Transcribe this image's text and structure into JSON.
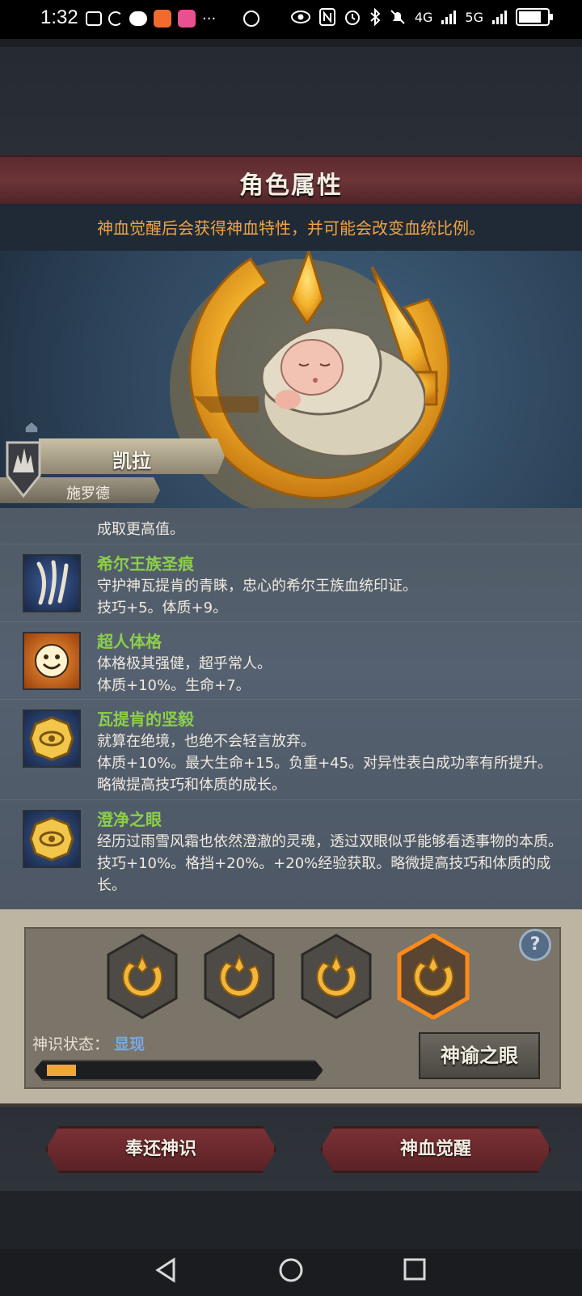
{
  "status_bar": {
    "time": "1:32",
    "right_labels": [
      "4G",
      "5G"
    ]
  },
  "header": {
    "title": "角色属性",
    "info": "神血觉醒后会获得神血特性，并可能会改变血统比例。"
  },
  "character": {
    "name": "凯拉",
    "family": "施罗德"
  },
  "traits_list": {
    "partial_line": "成取更高值。",
    "items": [
      {
        "name": "希尔王族圣痕",
        "icon": "claw-icon",
        "lines": [
          "守护神瓦提肯的青睐，忠心的希尔王族血统印证。",
          "技巧+5。体质+9。"
        ]
      },
      {
        "name": "超人体格",
        "icon": "smile-face-icon",
        "lines": [
          "体格极其强健，超乎常人。",
          "体质+10%。生命+7。"
        ]
      },
      {
        "name": "瓦提肯的坚毅",
        "icon": "golden-eye-medal-icon",
        "lines": [
          "就算在绝境，也绝不会轻言放弃。",
          "体质+10%。最大生命+15。负重+45。对异性表白成功率有所提升。",
          "略微提高技巧和体质的成长。"
        ]
      },
      {
        "name": "澄净之眼",
        "icon": "golden-eye-medal-icon",
        "lines": [
          "经历过雨雪风霜也依然澄澈的灵魂，透过双眼似乎能够看透事物的本质。",
          "技巧+10%。格挡+20%。+20%经验获取。略微提高技巧和体质的成",
          "长。"
        ]
      }
    ]
  },
  "awakening_panel": {
    "slots": [
      {
        "icon": "crescent-emblem-icon",
        "selected": false
      },
      {
        "icon": "crescent-emblem-icon",
        "selected": false
      },
      {
        "icon": "crescent-emblem-icon",
        "selected": false
      },
      {
        "icon": "crescent-emblem-icon",
        "selected": true
      }
    ],
    "status_label": "神识状态：",
    "status_value": "显现",
    "progress": 0.11,
    "help_symbol": "?",
    "oracle_button": "神谕之眼"
  },
  "actions": {
    "return_button": "奉还神识",
    "awaken_button": "神血觉醒"
  },
  "colors": {
    "accent_orange": "#f0a346",
    "trait_name_green": "#8ccf4a",
    "status_blue": "#7aa8e0",
    "banner_red": "#6d3538"
  }
}
